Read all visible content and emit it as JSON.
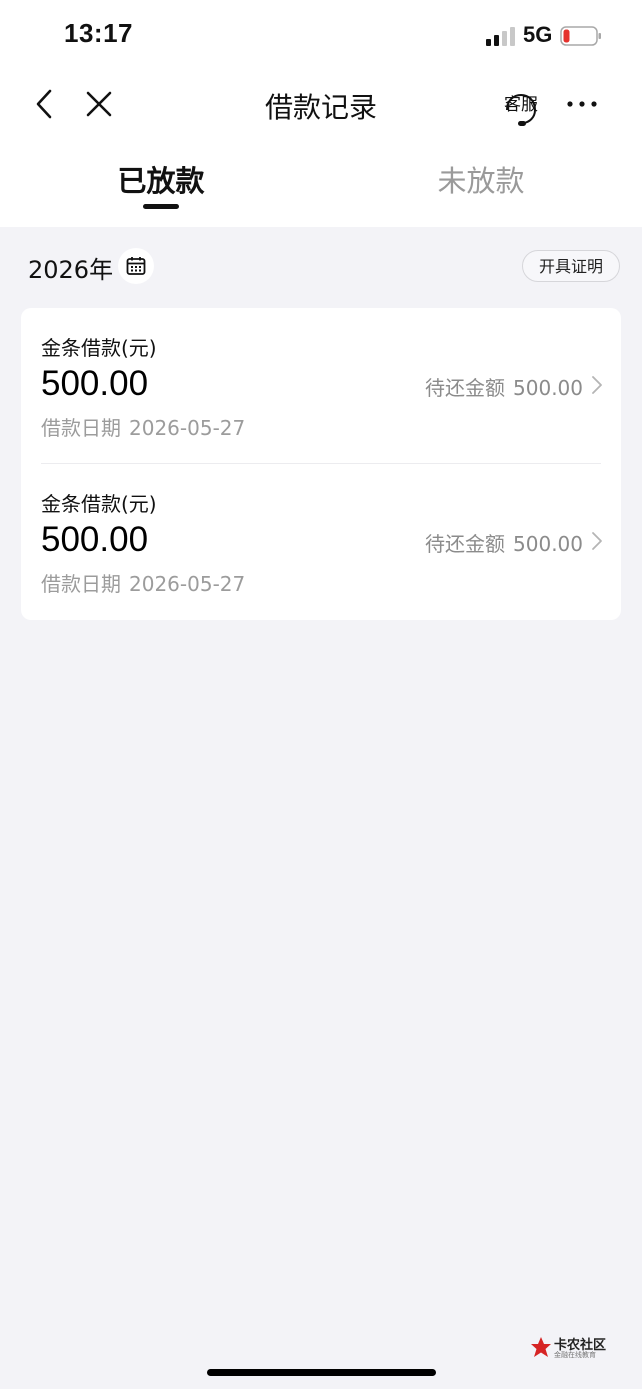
{
  "status_bar": {
    "time": "13:17",
    "network": "5G",
    "battery_color": "#e5322d"
  },
  "nav": {
    "title": "借款记录",
    "service_label": "客服"
  },
  "tabs": [
    {
      "label": "已放款",
      "active": true
    },
    {
      "label": "未放款",
      "active": false
    }
  ],
  "filter": {
    "year": "2026年",
    "cert_button": "开具证明"
  },
  "loans": [
    {
      "type": "金条借款(元)",
      "amount": "500.00",
      "date_label": "借款日期",
      "date": "2026-05-27",
      "remaining_label": "待还金额",
      "remaining": "500.00"
    },
    {
      "type": "金条借款(元)",
      "amount": "500.00",
      "date_label": "借款日期",
      "date": "2026-05-27",
      "remaining_label": "待还金额",
      "remaining": "500.00"
    }
  ],
  "watermark": {
    "title": "卡农社区",
    "subtitle": "金融在线教育",
    "color": "#d62424"
  }
}
